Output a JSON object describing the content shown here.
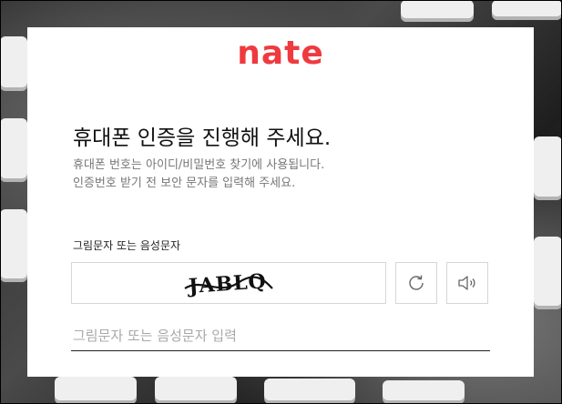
{
  "brand": {
    "logo_text": "nate",
    "accent": "#ef3a3f"
  },
  "page": {
    "title": "휴대폰 인증을 진행해 주세요.",
    "description_line1": "휴대폰 번호는 아이디/비밀번호 찾기에 사용됩니다.",
    "description_line2": "인증번호 받기 전 보안 문자를 입력해 주세요."
  },
  "captcha": {
    "label": "그림문자 또는 음성문자",
    "image_text": "JABLQ",
    "refresh_icon": "refresh-icon",
    "audio_icon": "speaker-icon",
    "input_placeholder": "그림문자 또는 음성문자 입력",
    "input_value": ""
  }
}
